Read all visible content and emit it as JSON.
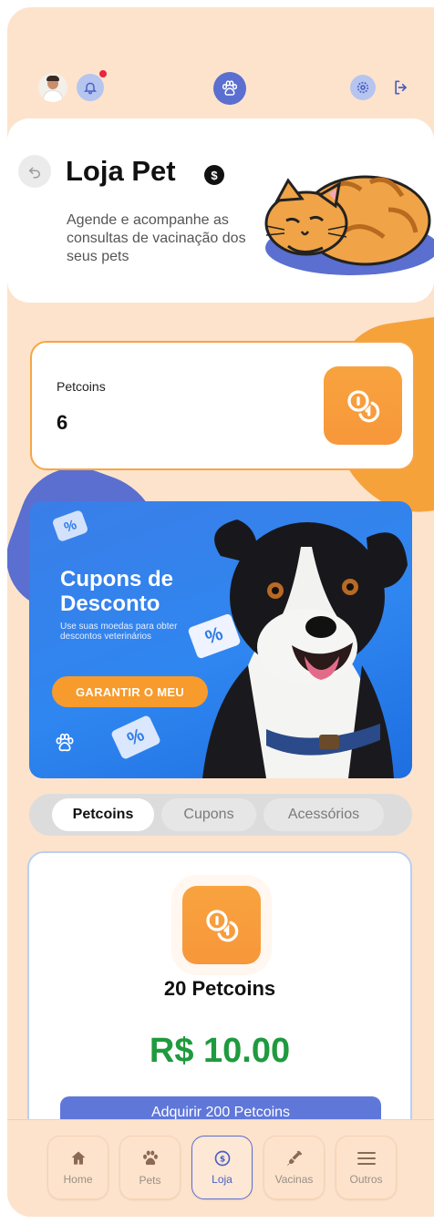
{
  "header": {
    "title": "Loja Pet",
    "title_badge": "$",
    "subtitle": "Agende e acompanhe as consultas de vacinação dos seus pets"
  },
  "topbar": {
    "notification_badge": "1"
  },
  "balance": {
    "label": "Petcoins",
    "value": "6"
  },
  "banner": {
    "title": "Cupons de\nDesconto",
    "text": "Use suas moedas para obter descontos veterinários",
    "button": "GARANTIR O MEU",
    "ticket_glyph": "%"
  },
  "tabs": [
    {
      "label": "Petcoins",
      "active": true
    },
    {
      "label": "Cupons",
      "active": false
    },
    {
      "label": "Acessórios",
      "active": false
    }
  ],
  "product": {
    "name": "20 Petcoins",
    "price": "R$ 10.00",
    "button": "Adquirir 200 Petcoins"
  },
  "nav": [
    {
      "label": "Home",
      "icon": "home-icon"
    },
    {
      "label": "Pets",
      "icon": "paw-icon"
    },
    {
      "label": "Loja",
      "icon": "coin-icon",
      "active": true
    },
    {
      "label": "Vacinas",
      "icon": "syringe-icon"
    },
    {
      "label": "Outros",
      "icon": "menu-icon"
    }
  ],
  "colors": {
    "background": "#fde3cc",
    "accent_orange": "#f7973a",
    "accent_blue": "#5a6fcf",
    "price_green": "#1f9a3e"
  }
}
